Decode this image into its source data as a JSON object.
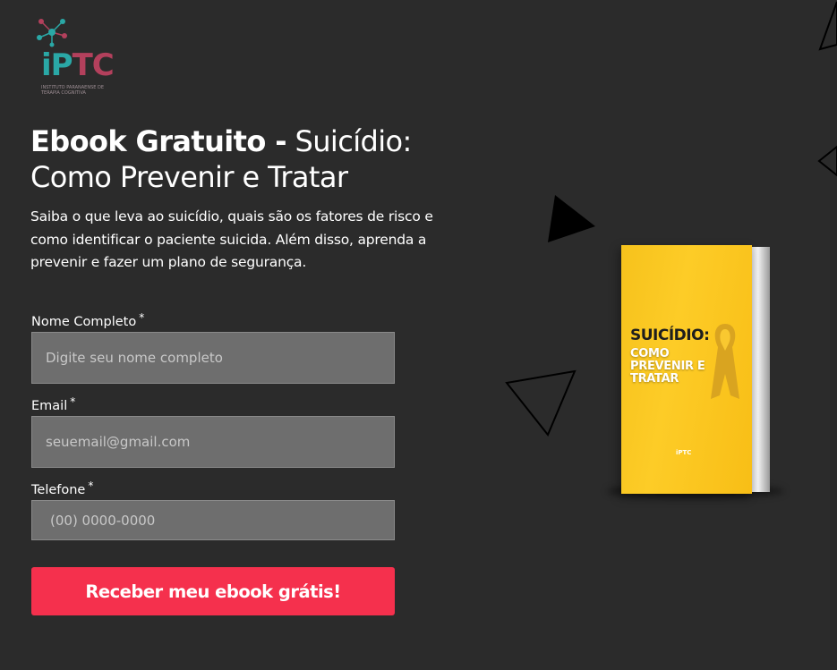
{
  "logo": {
    "wordmark_a": "iP",
    "wordmark_b": "TC",
    "subtitle": "INSTITUTO PARANAENSE DE TERAPIA COGNITIVA",
    "icon": "network-molecule-icon",
    "colors": {
      "teal": "#2aa8a6",
      "wine": "#b3405c"
    }
  },
  "hero": {
    "title_bold": "Ebook Gratuito -",
    "title_regular": "Suicídio: Como Prevenir e Tratar",
    "description": "Saiba o que leva ao suicídio, quais são os fatores de risco e como identificar o paciente suicida. Além disso, aprenda a prevenir e fazer um plano de segurança."
  },
  "form": {
    "name": {
      "label": "Nome Completo",
      "required": "*",
      "placeholder": "Digite seu nome completo",
      "value": ""
    },
    "email": {
      "label": "Email",
      "required": "*",
      "placeholder": "seuemail@gmail.com",
      "value": ""
    },
    "phone": {
      "label": "Telefone",
      "required": "*",
      "placeholder": "(00) 0000-0000",
      "value": ""
    },
    "submit_label": "Receber meu ebook grátis!"
  },
  "book": {
    "title": "SUICÍDIO:",
    "subtitle": "COMO PREVENIR E TRATAR",
    "logo_text": "iPTC",
    "icon": "awareness-ribbon-icon"
  },
  "colors": {
    "background": "#2b2b2b",
    "input_bg": "#6e6e6e",
    "button": "#f5304d",
    "book_cover": "#fdcc27"
  }
}
